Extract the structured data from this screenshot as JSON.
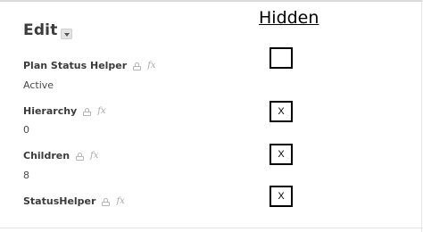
{
  "panel": {
    "title": "Edit",
    "fields": [
      {
        "label": "Plan Status Helper",
        "value": "Active"
      },
      {
        "label": "Hierarchy",
        "value": "0"
      },
      {
        "label": "Children",
        "value": "8"
      },
      {
        "label": "StatusHelper",
        "value": ""
      }
    ],
    "icons": {
      "lock": "lock-icon",
      "formula": "fx-icon",
      "formula_glyph": "fx",
      "toggle": "chevron-down-icon"
    }
  },
  "hidden_column": {
    "heading": "Hidden",
    "marks": [
      "",
      "X",
      "X",
      "X"
    ]
  }
}
